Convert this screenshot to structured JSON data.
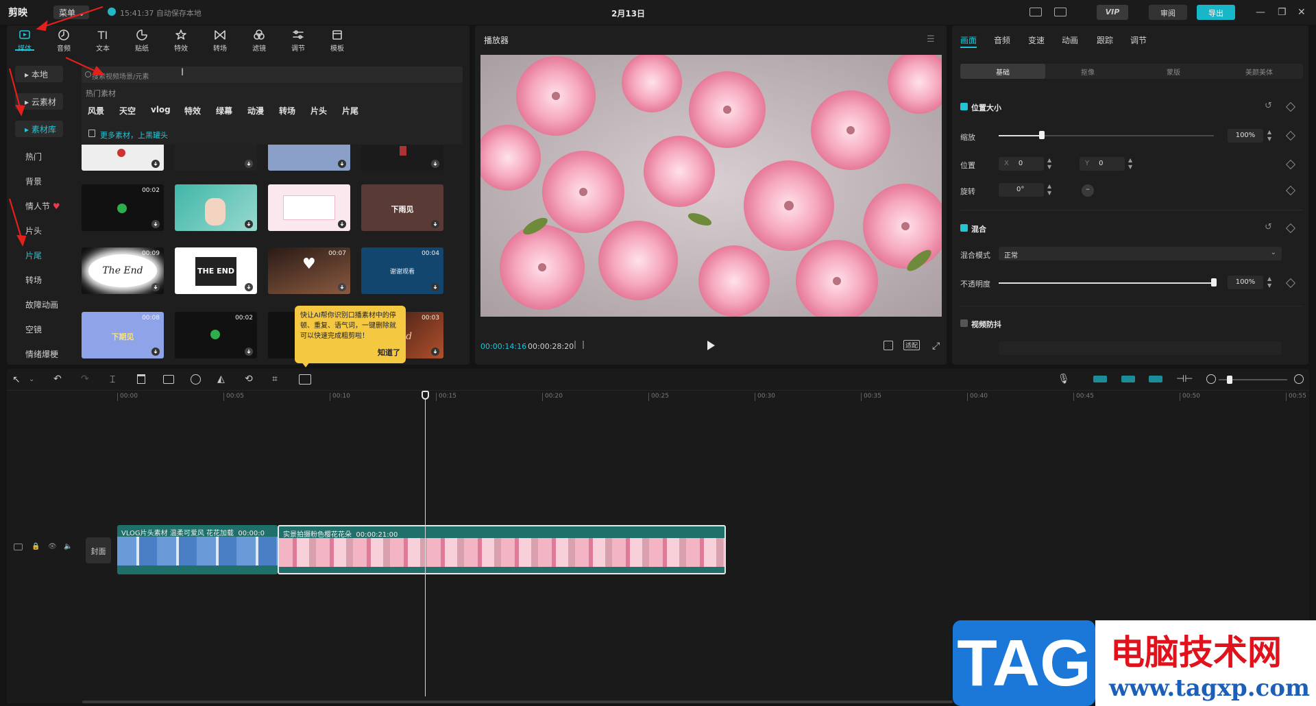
{
  "titlebar": {
    "logo": "剪映",
    "menu": "菜单",
    "autosave": "15:41:37 自动保存本地",
    "project_title": "2月13日",
    "vip": "VIP",
    "review": "审阅",
    "export": "导出"
  },
  "media_tabs": [
    {
      "label": "媒体",
      "icon": "media-icon"
    },
    {
      "label": "音频",
      "icon": "audio-icon"
    },
    {
      "label": "文本",
      "icon": "text-icon"
    },
    {
      "label": "贴纸",
      "icon": "sticker-icon"
    },
    {
      "label": "特效",
      "icon": "effects-icon"
    },
    {
      "label": "转场",
      "icon": "transition-icon"
    },
    {
      "label": "滤镜",
      "icon": "filter-icon"
    },
    {
      "label": "调节",
      "icon": "adjust-icon"
    },
    {
      "label": "模板",
      "icon": "template-icon"
    }
  ],
  "categories": {
    "local": "本地",
    "cloud": "云素材",
    "library": "素材库",
    "items": [
      "热门",
      "背景",
      "情人节",
      "片头",
      "片尾",
      "转场",
      "故障动画",
      "空镜",
      "情绪爆梗"
    ]
  },
  "search": {
    "placeholder": "搜索视频场景/元素",
    "hot_title": "热门素材",
    "hot_items": [
      "风景",
      "天空",
      "vlog",
      "特效",
      "绿幕",
      "动漫",
      "转场",
      "片头",
      "片尾"
    ],
    "more_link": "更多素材，上黑罐头"
  },
  "thumbnails": [
    {
      "duration": "00:02",
      "text": ""
    },
    {
      "duration": "",
      "text": ""
    },
    {
      "duration": "",
      "text": "下雨见"
    },
    {
      "duration": "00:09",
      "text": "The End"
    },
    {
      "duration": "",
      "text": "THE END"
    },
    {
      "duration": "00:07",
      "text": ""
    },
    {
      "duration": "00:04",
      "text": "谢谢观看"
    },
    {
      "duration": "00:08",
      "text": "下期见"
    },
    {
      "duration": "00:02",
      "text": ""
    },
    {
      "duration": "00:03",
      "text": "End"
    }
  ],
  "tooltip": {
    "text": "快让AI帮你识别口播素材中的停顿、重复、语气词，一键删除就可以快速完成粗剪啦！",
    "ok": "知道了"
  },
  "player": {
    "title": "播放器",
    "current_time": "00:00:14:16",
    "total_time": "00:00:28:20",
    "ratio": "适配"
  },
  "props": {
    "tabs": [
      "画面",
      "音频",
      "变速",
      "动画",
      "跟踪",
      "调节"
    ],
    "subtabs": [
      "基础",
      "抠像",
      "蒙版",
      "美颜美体"
    ],
    "position_size": "位置大小",
    "scale_label": "缩放",
    "scale_value": "100%",
    "scale_fraction": 0.2,
    "position_label": "位置",
    "x_label": "X",
    "x_value": "0",
    "y_label": "Y",
    "y_value": "0",
    "rotate_label": "旋转",
    "rotate_value": "0°",
    "blend": "混合",
    "blend_mode_label": "混合模式",
    "blend_mode_value": "正常",
    "opacity_label": "不透明度",
    "opacity_value": "100%",
    "opacity_fraction": 1.0,
    "stabilize": "视频防抖"
  },
  "timeline": {
    "ruler": [
      "00:00",
      "00:05",
      "00:10",
      "00:15",
      "00:20",
      "00:25",
      "00:30",
      "00:35",
      "00:40",
      "00:45",
      "00:50",
      "00:55"
    ],
    "cover": "封面",
    "clip1_label": "VLOG片头素材 温柔可爱风 花花加载",
    "clip1_time": "00:00:0",
    "clip2_label": "实景拍摄粉色樱花花朵",
    "clip2_time": "00:00:21:00"
  },
  "watermark": {
    "tag": "TAG",
    "site_name": "电脑技术网",
    "url": "www.tagxp.com"
  },
  "colors": {
    "accent": "#22c5d6",
    "background": "#141414",
    "panel": "#1e1e1e",
    "clip": "#1f6f6a",
    "tooltip": "#f5c842"
  }
}
